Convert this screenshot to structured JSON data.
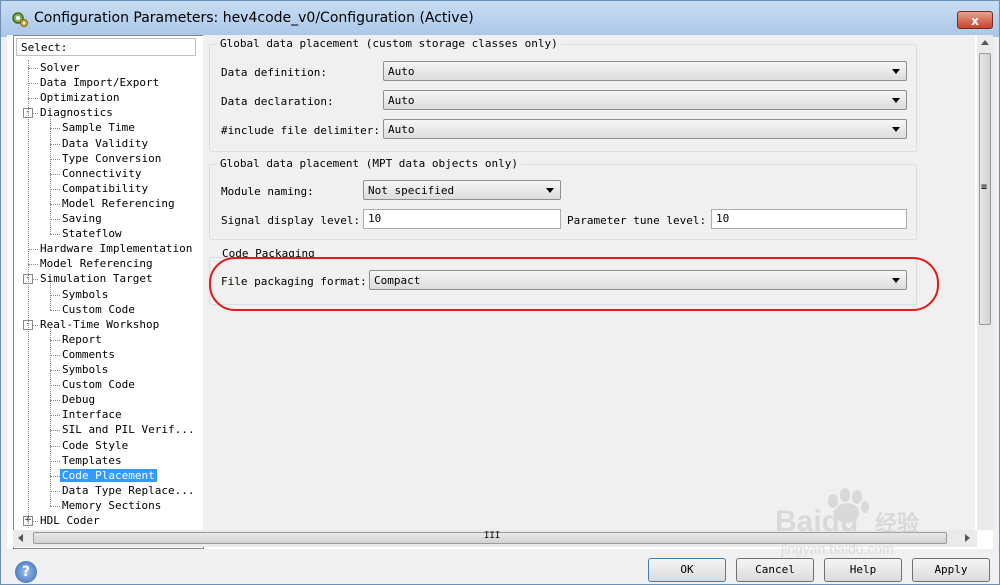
{
  "window": {
    "title": "Configuration Parameters: hev4code_v0/Configuration (Active)",
    "close_label": "x"
  },
  "tree": {
    "header": "Select:",
    "items": [
      {
        "label": "Solver"
      },
      {
        "label": "Data Import/Export"
      },
      {
        "label": "Optimization"
      },
      {
        "label": "Diagnostics",
        "expander": "-"
      },
      {
        "label": "Sample Time"
      },
      {
        "label": "Data Validity"
      },
      {
        "label": "Type Conversion"
      },
      {
        "label": "Connectivity"
      },
      {
        "label": "Compatibility"
      },
      {
        "label": "Model Referencing"
      },
      {
        "label": "Saving"
      },
      {
        "label": "Stateflow"
      },
      {
        "label": "Hardware Implementation"
      },
      {
        "label": "Model Referencing"
      },
      {
        "label": "Simulation Target",
        "expander": "-"
      },
      {
        "label": "Symbols"
      },
      {
        "label": "Custom Code"
      },
      {
        "label": "Real-Time Workshop",
        "expander": "-"
      },
      {
        "label": "Report"
      },
      {
        "label": "Comments"
      },
      {
        "label": "Symbols"
      },
      {
        "label": "Custom Code"
      },
      {
        "label": "Debug"
      },
      {
        "label": "Interface"
      },
      {
        "label": "SIL and PIL Verif..."
      },
      {
        "label": "Code Style"
      },
      {
        "label": "Templates"
      },
      {
        "label": "Code Placement",
        "selected": true
      },
      {
        "label": "Data Type Replace..."
      },
      {
        "label": "Memory Sections"
      },
      {
        "label": "HDL Coder",
        "expander": "+"
      }
    ]
  },
  "groups": {
    "custom_storage": {
      "title": "Global data placement (custom storage classes only)",
      "data_definition": {
        "label": "Data definition:",
        "value": "Auto"
      },
      "data_declaration": {
        "label": "Data declaration:",
        "value": "Auto"
      },
      "include_delimiter": {
        "label": "#include file delimiter:",
        "value": "Auto"
      }
    },
    "mpt": {
      "title": "Global data placement (MPT data objects only)",
      "module_naming": {
        "label": "Module naming:",
        "value": "Not specified"
      },
      "signal_display": {
        "label": "Signal display level:",
        "value": "10"
      },
      "parameter_tune": {
        "label": "Parameter tune level:",
        "value": "10"
      }
    },
    "code_packaging": {
      "title": "Code Packaging",
      "file_format": {
        "label": "File packaging format:",
        "value": "Compact"
      }
    }
  },
  "scrollbar": {
    "h_grip": "III",
    "v_grip": "≡"
  },
  "buttons": {
    "help_icon": "?",
    "ok": "OK",
    "cancel": "Cancel",
    "help": "Help",
    "apply": "Apply"
  },
  "watermark": {
    "brand": "Baidu",
    "cn": "经验",
    "url": "jingyan.baidu.com"
  },
  "colors": {
    "highlight": "#e21a1a",
    "selection": "#3399ff",
    "titlebar": "#b4cfee"
  }
}
